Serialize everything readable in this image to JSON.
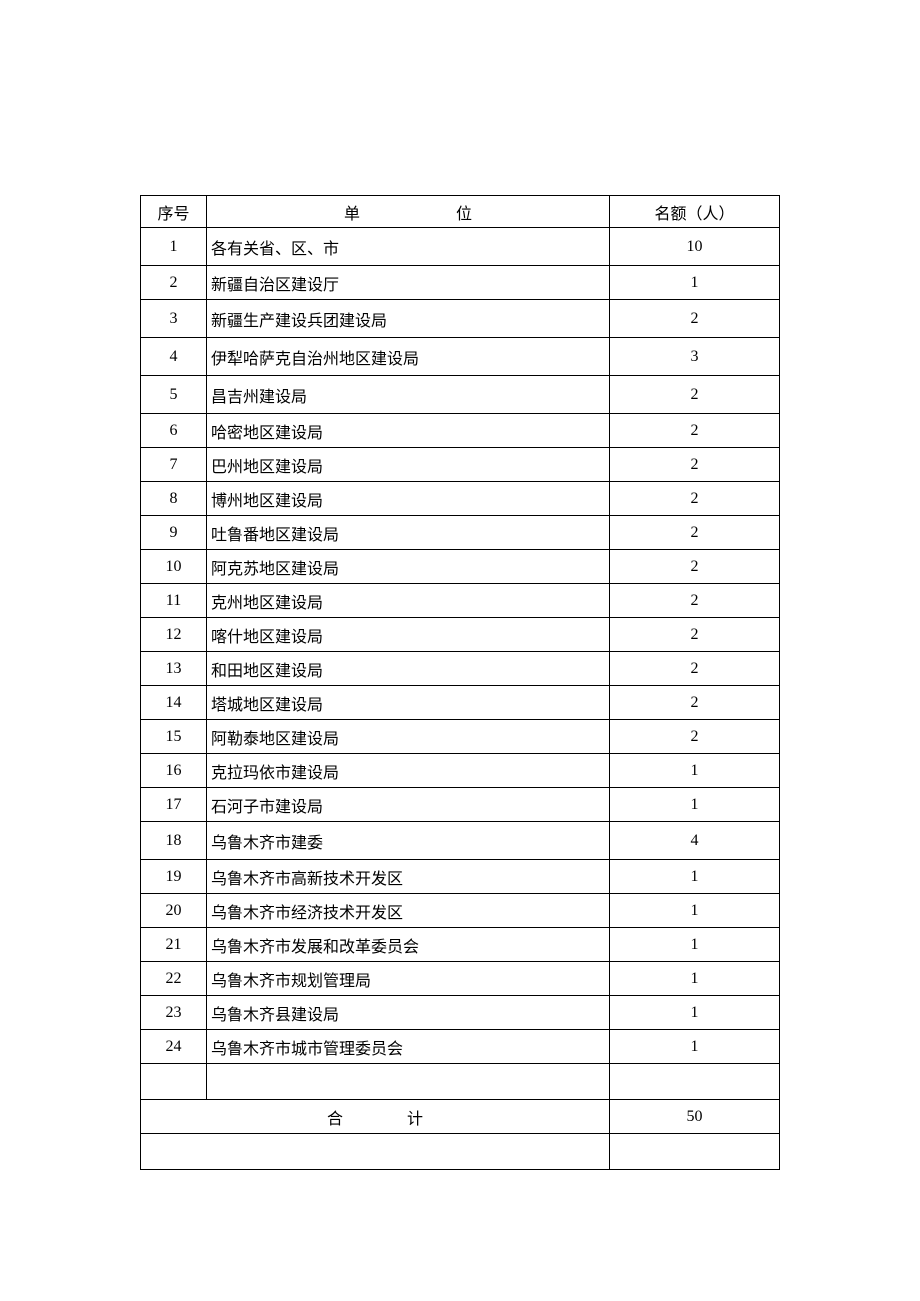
{
  "headers": {
    "seq": "序号",
    "unit": "单位",
    "quota": "名额（人）"
  },
  "rows": [
    {
      "seq": "1",
      "unit": "各有关省、区、市",
      "quota": "10"
    },
    {
      "seq": "2",
      "unit": "新疆自治区建设厅",
      "quota": "1"
    },
    {
      "seq": "3",
      "unit": "新疆生产建设兵团建设局",
      "quota": "2"
    },
    {
      "seq": "4",
      "unit": "伊犁哈萨克自治州地区建设局",
      "quota": "3"
    },
    {
      "seq": "5",
      "unit": "昌吉州建设局",
      "quota": "2"
    },
    {
      "seq": "6",
      "unit": "哈密地区建设局",
      "quota": "2"
    },
    {
      "seq": "7",
      "unit": "巴州地区建设局",
      "quota": "2"
    },
    {
      "seq": "8",
      "unit": "博州地区建设局",
      "quota": "2"
    },
    {
      "seq": "9",
      "unit": "吐鲁番地区建设局",
      "quota": "2"
    },
    {
      "seq": "10",
      "unit": "阿克苏地区建设局",
      "quota": "2"
    },
    {
      "seq": "11",
      "unit": "克州地区建设局",
      "quota": "2"
    },
    {
      "seq": "12",
      "unit": "喀什地区建设局",
      "quota": "2"
    },
    {
      "seq": "13",
      "unit": "和田地区建设局",
      "quota": "2"
    },
    {
      "seq": "14",
      "unit": "塔城地区建设局",
      "quota": "2"
    },
    {
      "seq": "15",
      "unit": "阿勒泰地区建设局",
      "quota": "2"
    },
    {
      "seq": "16",
      "unit": "克拉玛依市建设局",
      "quota": "1"
    },
    {
      "seq": "17",
      "unit": "石河子市建设局",
      "quota": "1"
    },
    {
      "seq": "18",
      "unit": "乌鲁木齐市建委",
      "quota": "4"
    },
    {
      "seq": "19",
      "unit": "乌鲁木齐市高新技术开发区",
      "quota": "1"
    },
    {
      "seq": "20",
      "unit": "乌鲁木齐市经济技术开发区",
      "quota": "1"
    },
    {
      "seq": "21",
      "unit": "乌鲁木齐市发展和改革委员会",
      "quota": "1"
    },
    {
      "seq": "22",
      "unit": "乌鲁木齐市规划管理局",
      "quota": "1"
    },
    {
      "seq": "23",
      "unit": "乌鲁木齐县建设局",
      "quota": "1"
    },
    {
      "seq": "24",
      "unit": "乌鲁木齐市城市管理委员会",
      "quota": "1"
    }
  ],
  "total": {
    "label": "合计",
    "value": "50"
  }
}
